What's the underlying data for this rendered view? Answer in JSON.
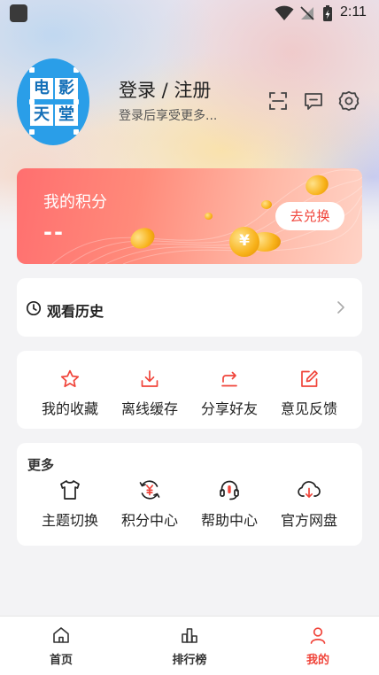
{
  "status_bar": {
    "time": "2:11"
  },
  "avatar": {
    "chars": [
      "电",
      "影",
      "天",
      "堂"
    ]
  },
  "profile": {
    "name": "登录 / 注册",
    "subtitle": "登录后享受更多..."
  },
  "points": {
    "title": "我的积分",
    "value": "--",
    "redeem_label": "去兑换"
  },
  "history": {
    "label": "观看历史"
  },
  "actions": [
    {
      "label": "我的收藏",
      "icon": "star-icon"
    },
    {
      "label": "离线缓存",
      "icon": "download-icon"
    },
    {
      "label": "分享好友",
      "icon": "share-icon"
    },
    {
      "label": "意见反馈",
      "icon": "edit-icon"
    }
  ],
  "more": {
    "title": "更多",
    "items": [
      {
        "label": "主题切换",
        "icon": "shirt-icon"
      },
      {
        "label": "积分中心",
        "icon": "yuan-refresh-icon"
      },
      {
        "label": "帮助中心",
        "icon": "headset-icon"
      },
      {
        "label": "官方网盘",
        "icon": "cloud-download-icon"
      }
    ]
  },
  "bottom_nav": [
    {
      "label": "首页",
      "icon": "home-icon",
      "active": false
    },
    {
      "label": "排行榜",
      "icon": "chart-icon",
      "active": false
    },
    {
      "label": "我的",
      "icon": "person-icon",
      "active": true
    }
  ],
  "colors": {
    "accent": "#f0443a",
    "points_card_start": "#ff6f6f",
    "avatar_bg": "#2a9ee8"
  }
}
